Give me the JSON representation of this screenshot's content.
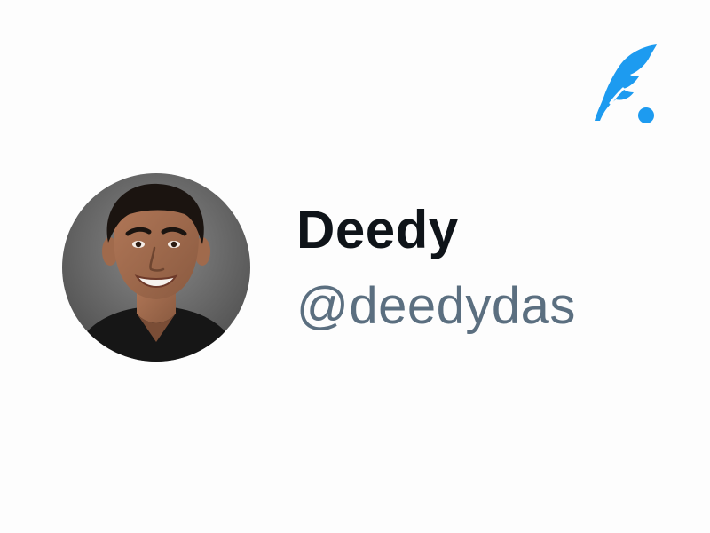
{
  "brand": {
    "icon": "quill-feather-icon",
    "color": "#1d9bf0"
  },
  "profile": {
    "display_name": "Deedy",
    "handle": "@deedydas",
    "handle_color": "#5b6f80",
    "avatar_icon": "profile-photo"
  }
}
